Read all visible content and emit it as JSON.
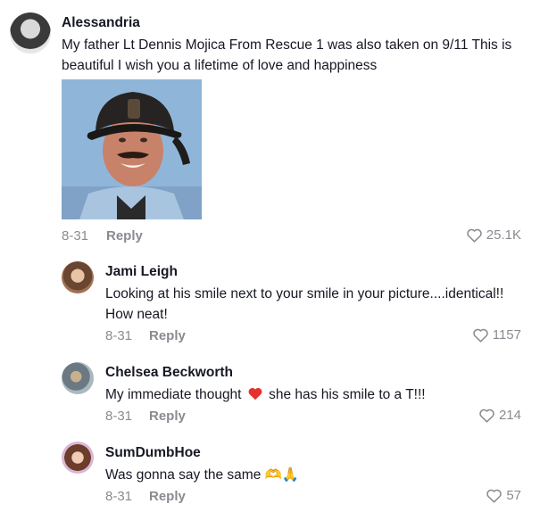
{
  "main_comment": {
    "author": "Alessandria",
    "text_line1": "My father Lt Dennis Mojica From Rescue 1 was also taken on 9/11 This is",
    "text_line2": "beautiful I wish you a lifetime of love and happiness",
    "date": "8-31",
    "reply_label": "Reply",
    "likes": "25.1K"
  },
  "replies": [
    {
      "author": "Jami Leigh",
      "text_line1": "Looking at his smile next to your smile in your picture....identical!!",
      "text_line2": "How neat!",
      "date": "8-31",
      "reply_label": "Reply",
      "likes": "1157"
    },
    {
      "author": "Chelsea Beckworth",
      "text_before": "My immediate thought",
      "text_after": "she has his smile to a T!!!",
      "date": "8-31",
      "reply_label": "Reply",
      "likes": "214"
    },
    {
      "author": "SumDumbHoe",
      "text": "Was gonna say the same 🫶🙏",
      "date": "8-31",
      "reply_label": "Reply",
      "likes": "57"
    }
  ],
  "icons": {
    "like": "heart-outline-icon",
    "emoji": "red-heart-icon"
  },
  "colors": {
    "text": "#161823",
    "muted": "#8a8b91",
    "emoji_heart": "#e5322d"
  }
}
